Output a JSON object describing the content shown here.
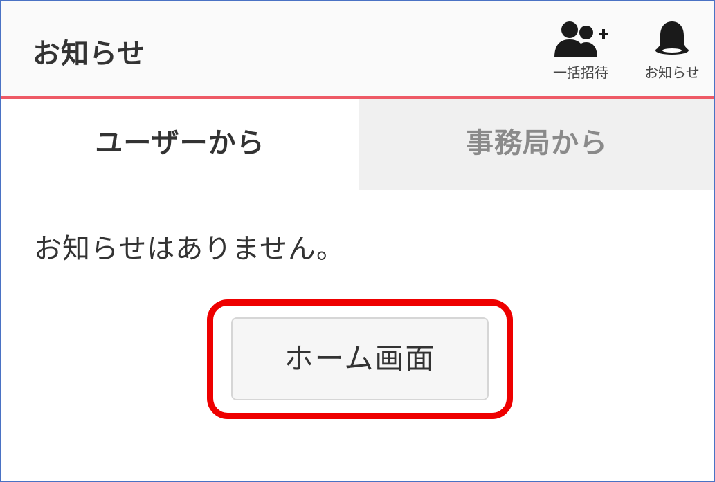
{
  "header": {
    "title": "お知らせ",
    "actions": [
      {
        "label": "一括招待",
        "icon": "add-users-icon"
      },
      {
        "label": "お知らせ",
        "icon": "bell-icon"
      }
    ]
  },
  "tabs": [
    {
      "label": "ユーザーから",
      "active": true
    },
    {
      "label": "事務局から",
      "active": false
    }
  ],
  "main": {
    "empty_message": "お知らせはありません。",
    "home_button_label": "ホーム画面"
  },
  "colors": {
    "header_underline": "#ee5a66",
    "highlight_box": "#ee0000",
    "inactive_tab_bg": "#f0f0f0",
    "frame_border": "#4a72c4"
  }
}
